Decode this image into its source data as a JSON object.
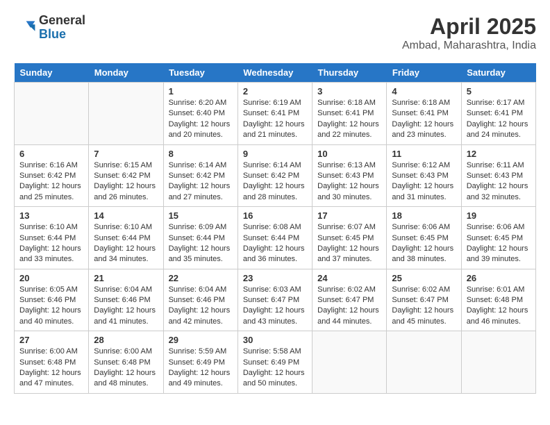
{
  "header": {
    "logo_general": "General",
    "logo_blue": "Blue",
    "month": "April 2025",
    "location": "Ambad, Maharashtra, India"
  },
  "days_of_week": [
    "Sunday",
    "Monday",
    "Tuesday",
    "Wednesday",
    "Thursday",
    "Friday",
    "Saturday"
  ],
  "weeks": [
    [
      {
        "day": "",
        "info": ""
      },
      {
        "day": "",
        "info": ""
      },
      {
        "day": "1",
        "info": "Sunrise: 6:20 AM\nSunset: 6:40 PM\nDaylight: 12 hours and 20 minutes."
      },
      {
        "day": "2",
        "info": "Sunrise: 6:19 AM\nSunset: 6:41 PM\nDaylight: 12 hours and 21 minutes."
      },
      {
        "day": "3",
        "info": "Sunrise: 6:18 AM\nSunset: 6:41 PM\nDaylight: 12 hours and 22 minutes."
      },
      {
        "day": "4",
        "info": "Sunrise: 6:18 AM\nSunset: 6:41 PM\nDaylight: 12 hours and 23 minutes."
      },
      {
        "day": "5",
        "info": "Sunrise: 6:17 AM\nSunset: 6:41 PM\nDaylight: 12 hours and 24 minutes."
      }
    ],
    [
      {
        "day": "6",
        "info": "Sunrise: 6:16 AM\nSunset: 6:42 PM\nDaylight: 12 hours and 25 minutes."
      },
      {
        "day": "7",
        "info": "Sunrise: 6:15 AM\nSunset: 6:42 PM\nDaylight: 12 hours and 26 minutes."
      },
      {
        "day": "8",
        "info": "Sunrise: 6:14 AM\nSunset: 6:42 PM\nDaylight: 12 hours and 27 minutes."
      },
      {
        "day": "9",
        "info": "Sunrise: 6:14 AM\nSunset: 6:42 PM\nDaylight: 12 hours and 28 minutes."
      },
      {
        "day": "10",
        "info": "Sunrise: 6:13 AM\nSunset: 6:43 PM\nDaylight: 12 hours and 30 minutes."
      },
      {
        "day": "11",
        "info": "Sunrise: 6:12 AM\nSunset: 6:43 PM\nDaylight: 12 hours and 31 minutes."
      },
      {
        "day": "12",
        "info": "Sunrise: 6:11 AM\nSunset: 6:43 PM\nDaylight: 12 hours and 32 minutes."
      }
    ],
    [
      {
        "day": "13",
        "info": "Sunrise: 6:10 AM\nSunset: 6:44 PM\nDaylight: 12 hours and 33 minutes."
      },
      {
        "day": "14",
        "info": "Sunrise: 6:10 AM\nSunset: 6:44 PM\nDaylight: 12 hours and 34 minutes."
      },
      {
        "day": "15",
        "info": "Sunrise: 6:09 AM\nSunset: 6:44 PM\nDaylight: 12 hours and 35 minutes."
      },
      {
        "day": "16",
        "info": "Sunrise: 6:08 AM\nSunset: 6:44 PM\nDaylight: 12 hours and 36 minutes."
      },
      {
        "day": "17",
        "info": "Sunrise: 6:07 AM\nSunset: 6:45 PM\nDaylight: 12 hours and 37 minutes."
      },
      {
        "day": "18",
        "info": "Sunrise: 6:06 AM\nSunset: 6:45 PM\nDaylight: 12 hours and 38 minutes."
      },
      {
        "day": "19",
        "info": "Sunrise: 6:06 AM\nSunset: 6:45 PM\nDaylight: 12 hours and 39 minutes."
      }
    ],
    [
      {
        "day": "20",
        "info": "Sunrise: 6:05 AM\nSunset: 6:46 PM\nDaylight: 12 hours and 40 minutes."
      },
      {
        "day": "21",
        "info": "Sunrise: 6:04 AM\nSunset: 6:46 PM\nDaylight: 12 hours and 41 minutes."
      },
      {
        "day": "22",
        "info": "Sunrise: 6:04 AM\nSunset: 6:46 PM\nDaylight: 12 hours and 42 minutes."
      },
      {
        "day": "23",
        "info": "Sunrise: 6:03 AM\nSunset: 6:47 PM\nDaylight: 12 hours and 43 minutes."
      },
      {
        "day": "24",
        "info": "Sunrise: 6:02 AM\nSunset: 6:47 PM\nDaylight: 12 hours and 44 minutes."
      },
      {
        "day": "25",
        "info": "Sunrise: 6:02 AM\nSunset: 6:47 PM\nDaylight: 12 hours and 45 minutes."
      },
      {
        "day": "26",
        "info": "Sunrise: 6:01 AM\nSunset: 6:48 PM\nDaylight: 12 hours and 46 minutes."
      }
    ],
    [
      {
        "day": "27",
        "info": "Sunrise: 6:00 AM\nSunset: 6:48 PM\nDaylight: 12 hours and 47 minutes."
      },
      {
        "day": "28",
        "info": "Sunrise: 6:00 AM\nSunset: 6:48 PM\nDaylight: 12 hours and 48 minutes."
      },
      {
        "day": "29",
        "info": "Sunrise: 5:59 AM\nSunset: 6:49 PM\nDaylight: 12 hours and 49 minutes."
      },
      {
        "day": "30",
        "info": "Sunrise: 5:58 AM\nSunset: 6:49 PM\nDaylight: 12 hours and 50 minutes."
      },
      {
        "day": "",
        "info": ""
      },
      {
        "day": "",
        "info": ""
      },
      {
        "day": "",
        "info": ""
      }
    ]
  ]
}
